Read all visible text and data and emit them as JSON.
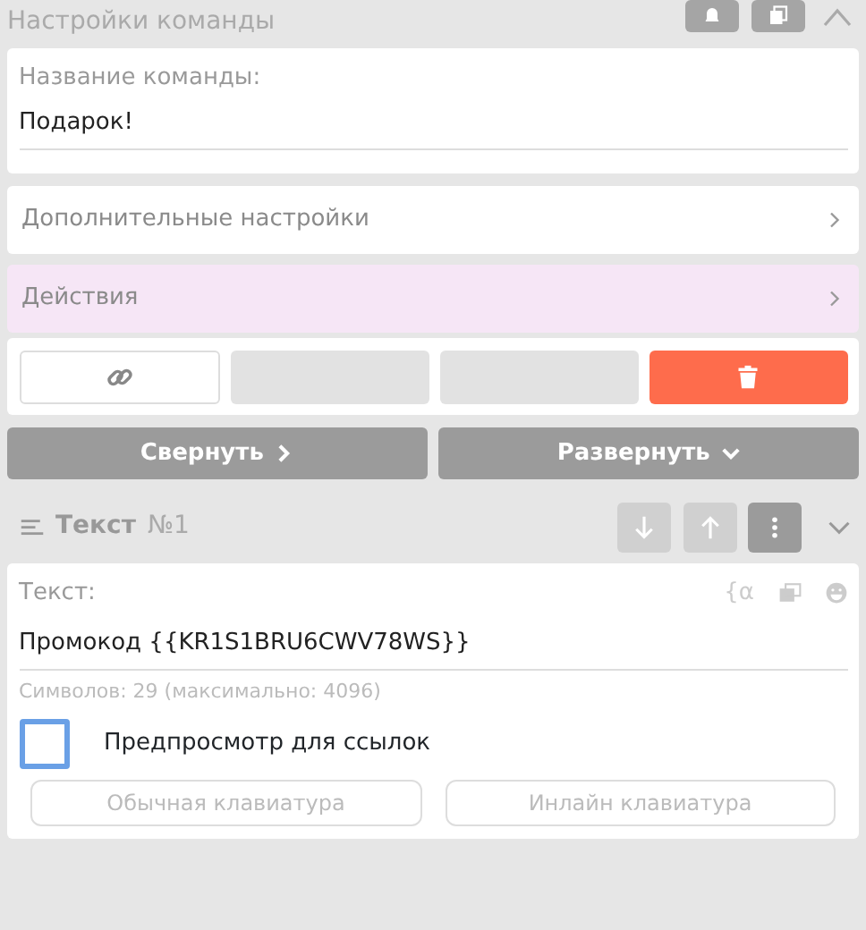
{
  "header": {
    "title": "Настройки команды"
  },
  "name_field": {
    "label": "Название команды:",
    "value": "Подарок!"
  },
  "sections": [
    {
      "label": "Дополнительные настройки",
      "highlighted": false
    },
    {
      "label": "Действия",
      "highlighted": true
    }
  ],
  "action_buttons": [
    {
      "kind": "link"
    },
    {
      "kind": "blank"
    },
    {
      "kind": "blank"
    },
    {
      "kind": "delete"
    }
  ],
  "collapse_buttons": [
    {
      "label": "Свернуть",
      "kind": "right"
    },
    {
      "label": "Развернуть",
      "kind": "down"
    }
  ],
  "block": {
    "title": "Текст",
    "number": "№1",
    "text_label": "Текст:",
    "variable_symbol": "{α",
    "text_value": "Промокод {{KR1S1BRU6CWV78WS}}",
    "counter": "Символов: 29 (максимально: 4096)",
    "preview": {
      "label": "Предпросмотр для ссылок",
      "checked": false
    },
    "keyboard_buttons": [
      "Обычная клавиатура",
      "Инлайн клавиатура"
    ]
  }
}
